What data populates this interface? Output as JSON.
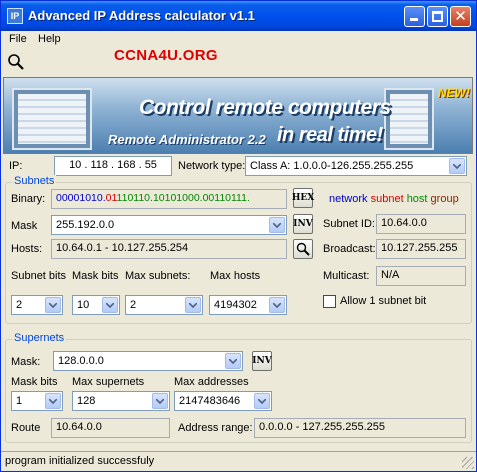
{
  "window": {
    "title": "Advanced IP Address calculator v1.1"
  },
  "menu": {
    "file": "File",
    "help": "Help"
  },
  "brand": "CCNA4U.ORG",
  "banner": {
    "headline": "Control remote computers",
    "product": "Remote Administrator 2.2",
    "tagline": "in real time!",
    "badge": "NEW!"
  },
  "ip": {
    "label": "IP:",
    "value": "10 . 118 . 168 . 55",
    "network_type_label": "Network type:",
    "network_type_value": "Class A:  1.0.0.0-126.255.255.255"
  },
  "subnets": {
    "title": "Subnets",
    "binary_label": "Binary:",
    "binary_network": "00001010.",
    "binary_subnet": "01",
    "binary_host": "110110.10101000.00110111.",
    "hex_button": "HEX",
    "legend_network": "network",
    "legend_subnet": "subnet",
    "legend_host": "host",
    "legend_group": "group",
    "mask_label": "Mask",
    "mask_value": "255.192.0.0",
    "inv_button": "INV",
    "subnet_id_label": "Subnet ID:",
    "subnet_id_value": "10.64.0.0",
    "hosts_label": "Hosts:",
    "hosts_value": "10.64.0.1 - 10.127.255.254",
    "broadcast_label": "Broadcast:",
    "broadcast_value": "10.127.255.255",
    "subnet_bits_label": "Subnet bits",
    "mask_bits_label": "Mask bits",
    "max_subnets_label": "Max subnets:",
    "max_hosts_label": "Max hosts",
    "multicast_label": "Multicast:",
    "multicast_value": "N/A",
    "subnet_bits_value": "2",
    "mask_bits_value": "10",
    "max_subnets_value": "2",
    "max_hosts_value": "4194302",
    "allow_label": "Allow 1 subnet bit"
  },
  "supernets": {
    "title": "Supernets",
    "mask_label": "Mask:",
    "mask_value": "128.0.0.0",
    "inv_button": "INV",
    "mask_bits_label": "Mask bits",
    "max_supernets_label": "Max supernets",
    "max_addresses_label": "Max addresses",
    "mask_bits_value": "1",
    "max_supernets_value": "128",
    "max_addresses_value": "2147483646",
    "route_label": "Route",
    "route_value": "10.64.0.0",
    "address_range_label": "Address range:",
    "address_range_value": "0.0.0.0 - 127.255.255.255"
  },
  "status": "program initialized successfuly",
  "colors": {
    "network": "#0000cc",
    "subnet": "#dd0000",
    "host": "#008800",
    "group": "#8b2500"
  }
}
